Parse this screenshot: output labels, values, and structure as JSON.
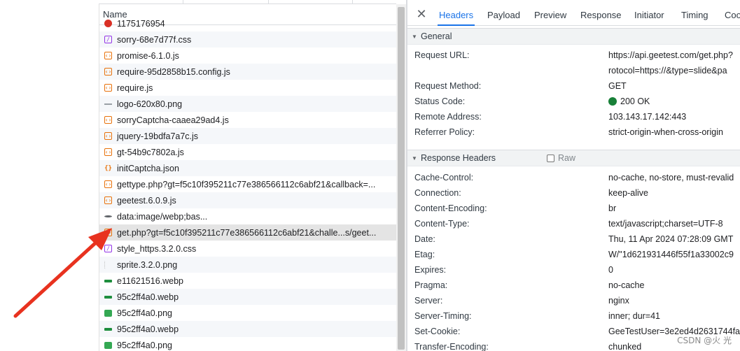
{
  "colors": {
    "accent": "#1a73e8",
    "arrow": "#e8321f",
    "status_ok": "#188038"
  },
  "network_list": {
    "header": "Name",
    "rows": [
      {
        "name": "1175176954",
        "icon": "error-icon",
        "type": "err"
      },
      {
        "name": "sorry-68e7d77f.css",
        "icon": "css-file-icon",
        "type": "css"
      },
      {
        "name": "promise-6.1.0.js",
        "icon": "script-file-icon",
        "type": "js"
      },
      {
        "name": "require-95d2858b15.config.js",
        "icon": "script-file-icon",
        "type": "js"
      },
      {
        "name": "require.js",
        "icon": "script-file-icon",
        "type": "js"
      },
      {
        "name": "logo-620x80.png",
        "icon": "image-file-icon",
        "type": "img-line"
      },
      {
        "name": "sorryCaptcha-caaea29ad4.js",
        "icon": "script-file-icon",
        "type": "js"
      },
      {
        "name": "jquery-19bdfa7a7c.js",
        "icon": "script-file-icon",
        "type": "js"
      },
      {
        "name": "gt-54b9c7802a.js",
        "icon": "script-file-icon",
        "type": "js"
      },
      {
        "name": "initCaptcha.json",
        "icon": "json-file-icon",
        "type": "json"
      },
      {
        "name": "gettype.php?gt=f5c10f395211c77e386566112c6abf21&callback=...",
        "icon": "script-file-icon",
        "type": "js"
      },
      {
        "name": "geetest.6.0.9.js",
        "icon": "script-file-icon",
        "type": "js"
      },
      {
        "name": "data:image/webp;bas...",
        "icon": "data-uri-icon",
        "type": "img-dot"
      },
      {
        "name": "get.php?gt=f5c10f395211c77e386566112c6abf21&challe...s/geet...",
        "icon": "script-file-icon",
        "type": "js",
        "selected": true
      },
      {
        "name": "style_https.3.2.0.css",
        "icon": "css-file-icon",
        "type": "css"
      },
      {
        "name": "sprite.3.2.0.png",
        "icon": "image-file-icon",
        "type": "sprite"
      },
      {
        "name": "e11621516.webp",
        "icon": "webp-image-icon",
        "type": "webp"
      },
      {
        "name": "95c2ff4a0.webp",
        "icon": "webp-image-icon",
        "type": "webp"
      },
      {
        "name": "95c2ff4a0.png",
        "icon": "png-image-icon",
        "type": "png"
      },
      {
        "name": "95c2ff4a0.webp",
        "icon": "webp-image-icon",
        "type": "webp"
      },
      {
        "name": "95c2ff4a0.png",
        "icon": "png-image-icon",
        "type": "png"
      }
    ]
  },
  "details": {
    "close_icon": "close-icon",
    "tabs": [
      "Headers",
      "Payload",
      "Preview",
      "Response",
      "Initiator",
      "Timing",
      "Coo"
    ],
    "active_tab": "Headers",
    "general": {
      "title": "General",
      "rows": [
        {
          "key": "Request URL:",
          "value": "https://api.geetest.com/get.php?"
        },
        {
          "key": "",
          "value": "rotocol=https://&type=slide&pa"
        },
        {
          "key": "Request Method:",
          "value": "GET"
        },
        {
          "key": "Status Code:",
          "value": "200 OK",
          "status_dot": true
        },
        {
          "key": "Remote Address:",
          "value": "103.143.17.142:443"
        },
        {
          "key": "Referrer Policy:",
          "value": "strict-origin-when-cross-origin"
        }
      ]
    },
    "response_headers": {
      "title": "Response Headers",
      "raw_label": "Raw",
      "rows": [
        {
          "key": "Cache-Control:",
          "value": "no-cache, no-store, must-revalid"
        },
        {
          "key": "Connection:",
          "value": "keep-alive"
        },
        {
          "key": "Content-Encoding:",
          "value": "br"
        },
        {
          "key": "Content-Type:",
          "value": "text/javascript;charset=UTF-8"
        },
        {
          "key": "Date:",
          "value": "Thu, 11 Apr 2024 07:28:09 GMT"
        },
        {
          "key": "Etag:",
          "value": "W/\"1d621931446f55f1a33002c9"
        },
        {
          "key": "Expires:",
          "value": "0"
        },
        {
          "key": "Pragma:",
          "value": "no-cache"
        },
        {
          "key": "Server:",
          "value": "nginx"
        },
        {
          "key": "Server-Timing:",
          "value": "inner; dur=41"
        },
        {
          "key": "Set-Cookie:",
          "value": "GeeTestUser=3e2ed4d2631744fa"
        },
        {
          "key": "Transfer-Encoding:",
          "value": "chunked"
        }
      ]
    }
  },
  "watermark": "CSDN @火 光"
}
